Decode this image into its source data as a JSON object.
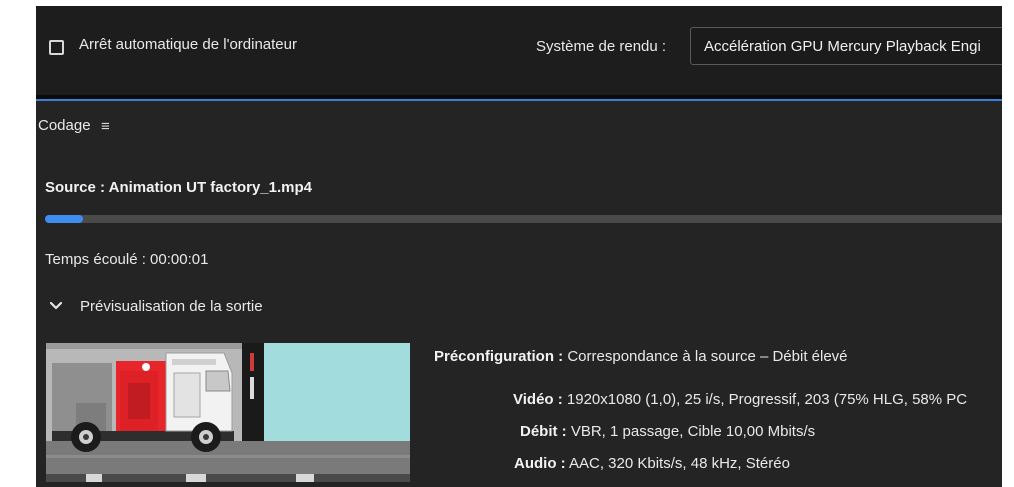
{
  "toolbar": {
    "auto_shutdown_label": "Arrêt automatique de l'ordinateur",
    "auto_shutdown_checked": false,
    "render_label": "Système de rendu :",
    "render_value": "Accélération GPU Mercury Playback Engi"
  },
  "panel": {
    "title": "Codage",
    "menu_icon": "hamburger-menu-icon"
  },
  "encoding": {
    "source": "Source : Animation UT factory_1.mp4",
    "progress_fraction": 0.04,
    "elapsed": "Temps écoulé : 00:00:01",
    "preview_toggle": "Prévisualisation de la sortie",
    "preview_expanded": true
  },
  "output": {
    "preset_key": "Préconfiguration :",
    "preset_value": "Correspondance à la source – Débit élevé",
    "video_key": "Vidéo :",
    "video_value": "1920x1080 (1,0), 25 i/s, Progressif, 203 (75% HLG, 58% PC",
    "bitrate_key": "Débit :",
    "bitrate_value": "VBR, 1 passage, Cible 10,00  Mbits/s",
    "audio_key": "Audio :",
    "audio_value": "AAC, 320  Kbits/s, 48 kHz, Stéréo"
  },
  "colors": {
    "accent": "#3d8ef0",
    "panel_bg": "#242424",
    "toolbar_bg": "#1d1d1d"
  }
}
